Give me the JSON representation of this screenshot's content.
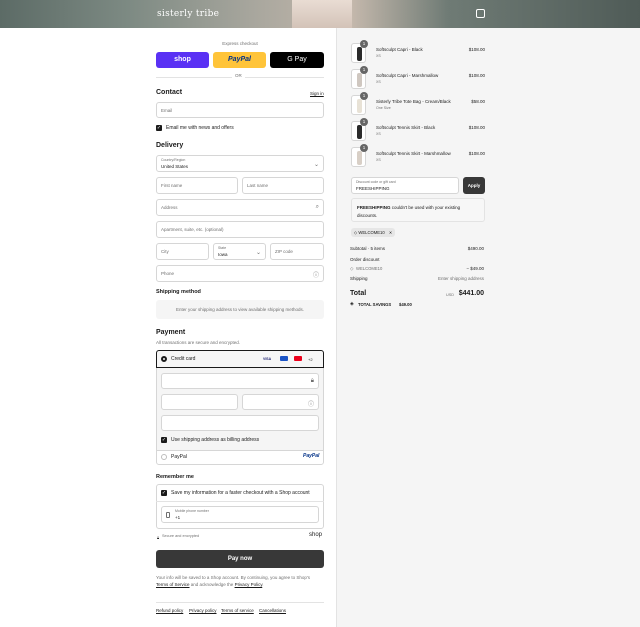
{
  "header": {
    "brand": "sisterly tribe",
    "cart_icon": "bag-icon"
  },
  "express": {
    "title": "Express checkout",
    "shop_label": "shop",
    "paypal_label": "PayPal",
    "gpay_label": "G Pay",
    "or_label": "OR",
    "colors": {
      "shop": "#5a31f4",
      "paypal": "#ffc439",
      "gpay": "#000000"
    }
  },
  "contact": {
    "title": "Contact",
    "signin_label": "Sign in",
    "email_placeholder": "Email",
    "news_label": "Email me with news and offers"
  },
  "delivery": {
    "title": "Delivery",
    "country_label": "Country/Region",
    "country_value": "United States",
    "first_name_placeholder": "First name",
    "last_name_placeholder": "Last name",
    "address_placeholder": "Address",
    "apartment_placeholder": "Apartment, suite, etc. (optional)",
    "city_placeholder": "City",
    "state_label": "State",
    "state_value": "Iowa",
    "zip_placeholder": "ZIP code",
    "phone_placeholder": "Phone"
  },
  "shipping_method": {
    "title": "Shipping method",
    "message": "Enter your shipping address to view available shipping methods."
  },
  "payment": {
    "title": "Payment",
    "subtitle": "All transactions are secure and encrypted.",
    "credit_card_label": "Credit card",
    "card_brands": [
      "VISA",
      "MC",
      "MC",
      "+2"
    ],
    "billing_label": "Use shipping address as billing address",
    "paypal_option": "PayPal",
    "paypal_logo": "PayPal"
  },
  "remember": {
    "title": "Remember me",
    "save_label": "Save my information for a faster checkout with a Shop account",
    "phone_label": "Mobile phone number",
    "phone_value": "+1",
    "secure_label": "Secure and encrypted",
    "shop_logo": "shop"
  },
  "pay": {
    "button_label": "Pay now",
    "legal_1": "Your info will be saved to a Shop account. By continuing, you agree to Shop's",
    "legal_terms": "Terms of Service",
    "legal_mid": " and acknowledge the ",
    "legal_privacy": "Privacy Policy",
    "legal_end": "."
  },
  "footer": {
    "links": [
      "Refund policy",
      "Privacy policy",
      "Terms of service",
      "Cancellations"
    ]
  },
  "cart": {
    "items": [
      {
        "name": "Softsculpt Capri - Black",
        "variant": "XS",
        "price": "$108.00",
        "qty": "1",
        "color": "#2b2b2b"
      },
      {
        "name": "Softsculpt Capri - Marshmallow",
        "variant": "XS",
        "price": "$108.00",
        "qty": "1",
        "color": "#cfc7c0"
      },
      {
        "name": "Sisterly Tribe Tote Bag - Cream/Black",
        "variant": "One Size",
        "price": "$58.00",
        "qty": "1",
        "color": "#e8e2d6"
      },
      {
        "name": "Softsculpt Tennis Skirt - Black",
        "variant": "XS",
        "price": "$108.00",
        "qty": "1",
        "color": "#2b2b2b"
      },
      {
        "name": "Softsculpt Tennis Skirt - Marshmallow",
        "variant": "XS",
        "price": "$108.00",
        "qty": "1",
        "color": "#d8cfc6"
      }
    ],
    "discount_label": "Discount code or gift card",
    "discount_value": "FREESHIPPING",
    "apply_label": "Apply",
    "error_code": "FREESHIPPING",
    "error_text": " couldn't be used with your existing discounts.",
    "applied_tag": "WELCOME10",
    "subtotal_label": "Subtotal · 5 items",
    "subtotal_value": "$490.00",
    "order_discount_label": "Order discount",
    "discount_code": "WELCOME10",
    "discount_amount": "− $49.00",
    "shipping_label": "Shipping",
    "shipping_value": "Enter shipping address",
    "total_label": "Total",
    "currency": "USD",
    "total_value": "$441.00",
    "savings_label": "TOTAL SAVINGS",
    "savings_value": "$49.00"
  }
}
